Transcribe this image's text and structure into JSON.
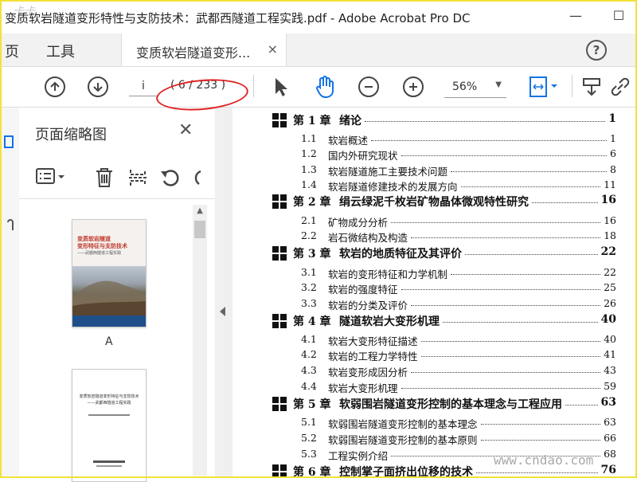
{
  "window": {
    "title": "变质软岩隧道变形特性与支防技术：武都西隧道工程实践.pdf - Adobe Acrobat Pro DC",
    "watermark_top": "卡卡",
    "minimize": "—",
    "maximize": "☐"
  },
  "menu": {
    "home_fragment": "页",
    "tools": "工具",
    "tab_label": "变质软岩隧道变形...",
    "tab_close": "×",
    "help": "?"
  },
  "toolbar": {
    "page_input": "i",
    "page_count": "( 6 / 233 )",
    "zoom": "56%",
    "zoom_caret": "▼"
  },
  "panel": {
    "title": "页面缩略图",
    "close": "✕",
    "thumbs": [
      {
        "label": "A",
        "title_lines": [
          "变质软岩隧道",
          "变形特征与支防技术",
          "——武都西隧道工程实践"
        ]
      },
      {
        "label": "",
        "title_lines": [
          "变质软岩隧道变形特征与支防技术",
          "——武都西隧道工程实践"
        ]
      }
    ]
  },
  "toc": [
    {
      "kind": "chap",
      "num": "第 1 章",
      "text": "绪论",
      "page": "1"
    },
    {
      "kind": "sec",
      "num": "1.1",
      "text": "软岩概述",
      "page": "1"
    },
    {
      "kind": "sec",
      "num": "1.2",
      "text": "国内外研究现状",
      "page": "6"
    },
    {
      "kind": "sec",
      "num": "1.3",
      "text": "软岩隧道施工主要技术问题",
      "page": "8"
    },
    {
      "kind": "sec",
      "num": "1.4",
      "text": "软岩隧道修建技术的发展方向",
      "page": "11"
    },
    {
      "kind": "chap",
      "num": "第 2 章",
      "text": "绢云绿泥千枚岩矿物晶体微观特性研究",
      "page": "16"
    },
    {
      "kind": "sec",
      "num": "2.1",
      "text": "矿物成分分析",
      "page": "16"
    },
    {
      "kind": "sec",
      "num": "2.2",
      "text": "岩石微结构及构造",
      "page": "18"
    },
    {
      "kind": "chap",
      "num": "第 3 章",
      "text": "软岩的地质特征及其评价",
      "page": "22"
    },
    {
      "kind": "sec",
      "num": "3.1",
      "text": "软岩的变形特征和力学机制",
      "page": "22"
    },
    {
      "kind": "sec",
      "num": "3.2",
      "text": "软岩的强度特征",
      "page": "25"
    },
    {
      "kind": "sec",
      "num": "3.3",
      "text": "软岩的分类及评价",
      "page": "26"
    },
    {
      "kind": "chap",
      "num": "第 4 章",
      "text": "隧道软岩大变形机理",
      "page": "40"
    },
    {
      "kind": "sec",
      "num": "4.1",
      "text": "软岩大变形特征描述",
      "page": "40"
    },
    {
      "kind": "sec",
      "num": "4.2",
      "text": "软岩的工程力学特性",
      "page": "41"
    },
    {
      "kind": "sec",
      "num": "4.3",
      "text": "软岩变形成因分析",
      "page": "43"
    },
    {
      "kind": "sec",
      "num": "4.4",
      "text": "软岩大变形机理",
      "page": "59"
    },
    {
      "kind": "chap",
      "num": "第 5 章",
      "text": "软弱围岩隧道变形控制的基本理念与工程应用",
      "page": "63"
    },
    {
      "kind": "sec",
      "num": "5.1",
      "text": "软弱围岩隧道变形控制的基本理念",
      "page": "63"
    },
    {
      "kind": "sec",
      "num": "5.2",
      "text": "软弱围岩隧道变形控制的基本原则",
      "page": "66"
    },
    {
      "kind": "sec",
      "num": "5.3",
      "text": "工程实例介绍",
      "page": "68"
    },
    {
      "kind": "chap",
      "num": "第 6 章",
      "text": "控制掌子面挤出位移的技术",
      "page": "76"
    }
  ],
  "watermark_bottom": "www.cndao.com"
}
